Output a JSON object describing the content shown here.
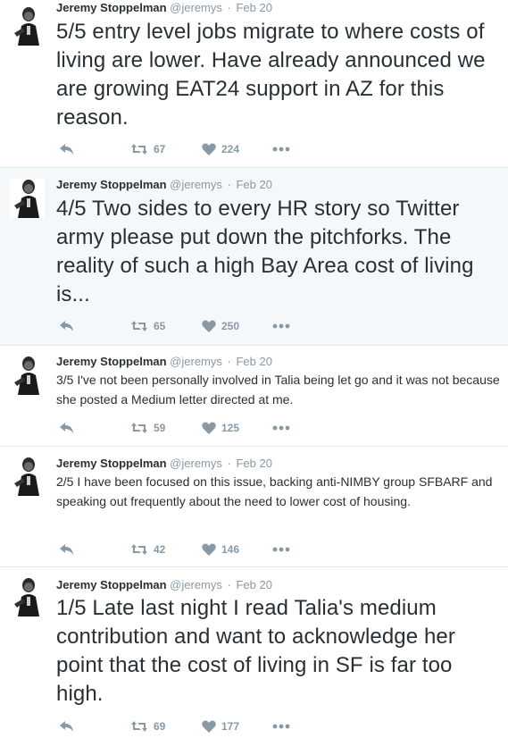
{
  "colors": {
    "text": "#292f33",
    "meta": "#8899a6",
    "highlight": "#f5f8fa",
    "divider": "#e1e8ed"
  },
  "icons": {
    "reply": "reply-icon",
    "retweet": "retweet-icon",
    "like": "heart-icon",
    "more": "more-dots-icon"
  },
  "tweets": [
    {
      "name": "Jeremy Stoppelman",
      "handle": "@jeremys",
      "separator": "·",
      "time": "Feb 20",
      "text": "5/5 entry level jobs migrate to where costs of living are lower. Have already announced we are growing EAT24 support in AZ for this reason.",
      "retweets": "67",
      "likes": "224"
    },
    {
      "name": "Jeremy Stoppelman",
      "handle": "@jeremys",
      "separator": "·",
      "time": "Feb 20",
      "text": "4/5 Two sides to every HR story so Twitter army please put down the pitchforks. The reality of such a high Bay Area cost of living is...",
      "retweets": "65",
      "likes": "250"
    },
    {
      "name": "Jeremy Stoppelman",
      "handle": "@jeremys",
      "separator": "·",
      "time": "Feb 20",
      "text": "3/5 I've not been personally involved in Talia being let go and it was not because she posted a Medium letter directed at me.",
      "retweets": "59",
      "likes": "125"
    },
    {
      "name": "Jeremy Stoppelman",
      "handle": "@jeremys",
      "separator": "·",
      "time": "Feb 20",
      "text": "2/5 I have been focused on this issue, backing anti-NIMBY group SFBARF and speaking out frequently about the need to lower cost of housing.",
      "retweets": "42",
      "likes": "146"
    },
    {
      "name": "Jeremy Stoppelman",
      "handle": "@jeremys",
      "separator": "·",
      "time": "Feb 20",
      "text": "1/5 Late last night I read Talia's medium contribution and want to acknowledge her point that the cost of living in SF is far too high.",
      "retweets": "69",
      "likes": "177"
    }
  ]
}
